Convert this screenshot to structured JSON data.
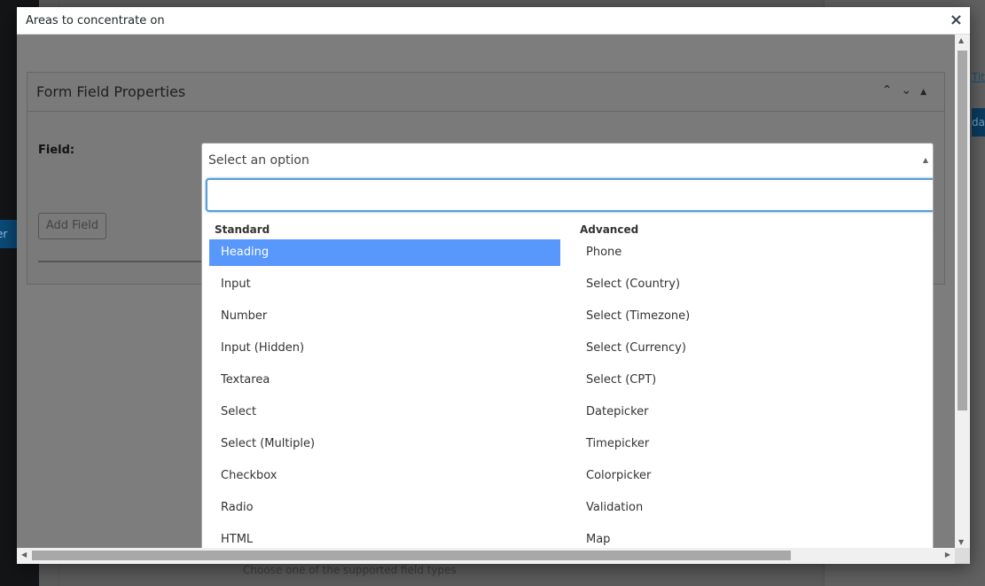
{
  "modal": {
    "title": "Areas to concentrate on",
    "close": "×"
  },
  "postbox": {
    "title": "Form Field Properties",
    "controls": [
      "⌃",
      "⌄",
      "▲"
    ],
    "field_label": "Field:",
    "add_field_button": "Add Field"
  },
  "select": {
    "value": "Select an option",
    "arrow": "▲",
    "search_value": ""
  },
  "groups": {
    "standard": {
      "label": "Standard",
      "options": [
        "Heading",
        "Input",
        "Number",
        "Input (Hidden)",
        "Textarea",
        "Select",
        "Select (Multiple)",
        "Checkbox",
        "Radio",
        "HTML"
      ],
      "highlighted": "Heading"
    },
    "advanced": {
      "label": "Advanced",
      "options": [
        "Phone",
        "Select (Country)",
        "Select (Timezone)",
        "Select (Currency)",
        "Select (CPT)",
        "Datepicker",
        "Timepicker",
        "Colorpicker",
        "Validation",
        "Map"
      ]
    }
  },
  "background": {
    "hint_text": "Choose one of the supported field types",
    "admin_tab_text": "er",
    "side_link": "Tit",
    "side_button": "dat"
  },
  "colors": {
    "highlight": "#5897fb",
    "focus_border": "#5b9dd9",
    "overlay": "#7d7d7d"
  }
}
